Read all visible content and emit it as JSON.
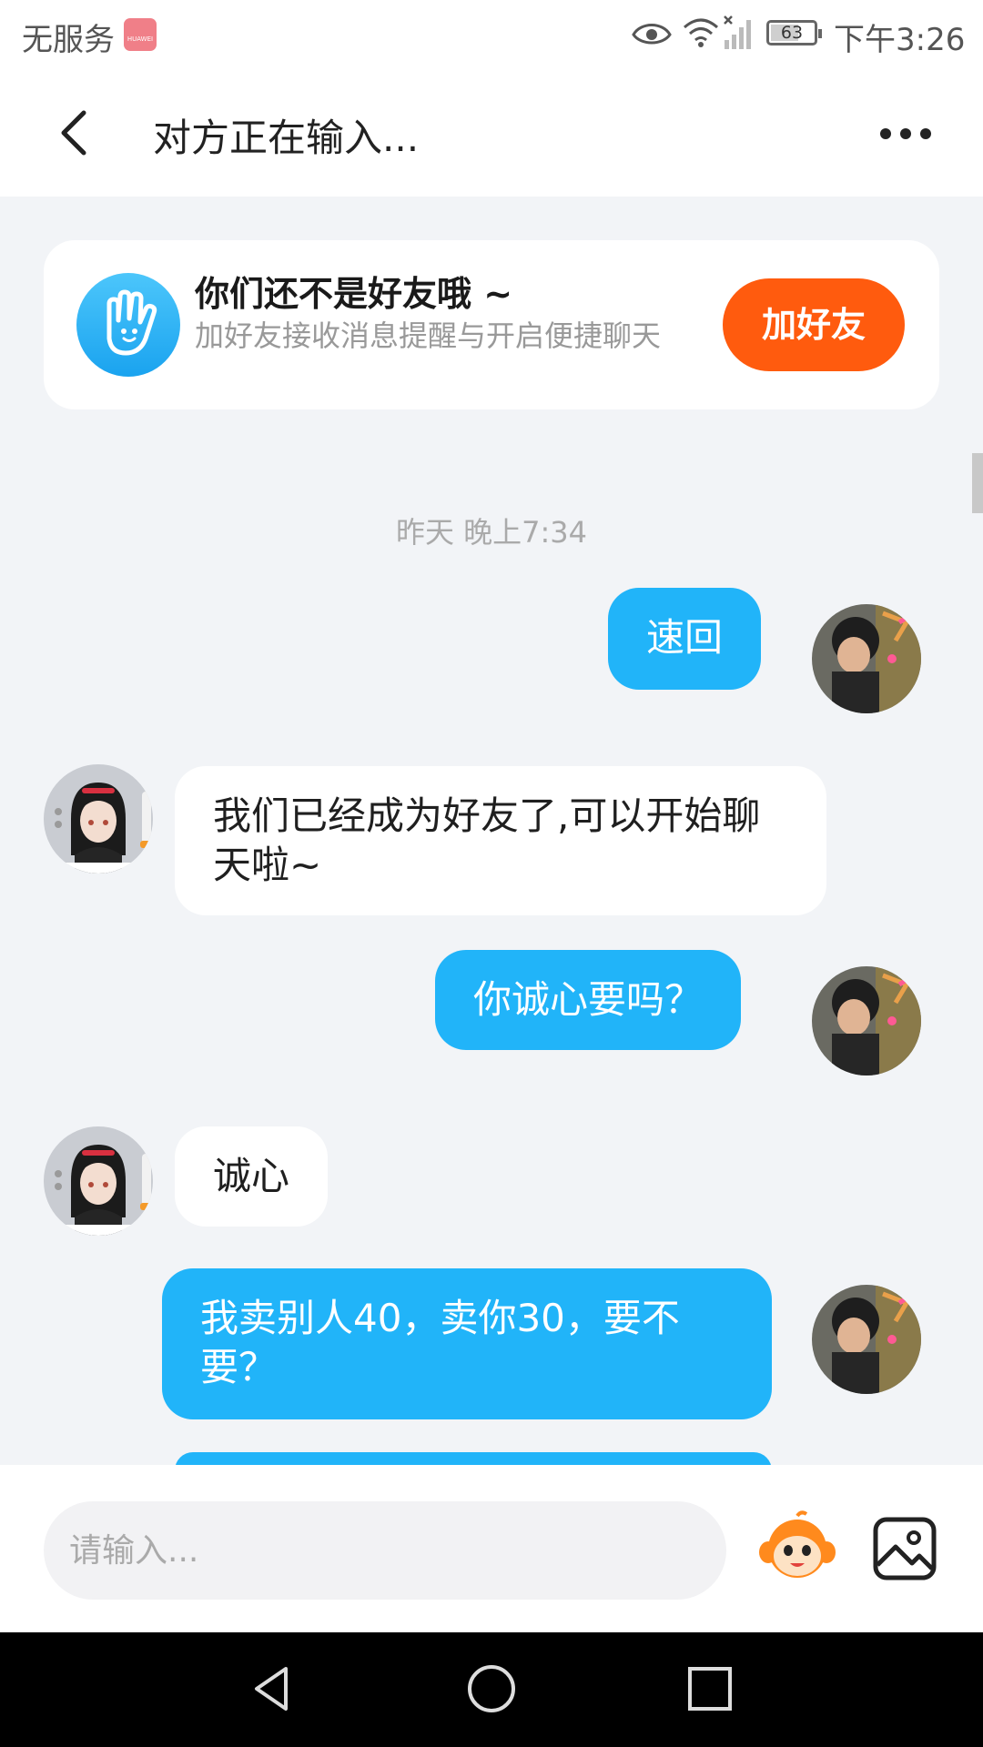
{
  "status_bar": {
    "carrier": "无服务",
    "carrier_badge": "HUAWEI",
    "battery": "63",
    "time": "下午3:26",
    "icons": [
      "eye-icon",
      "wifi-icon",
      "signal-icon",
      "battery-icon"
    ]
  },
  "header": {
    "title": "对方正在输入...",
    "back_icon": "chevron-left-icon",
    "more_icon": "more-dots-icon"
  },
  "friend_card": {
    "title": "你们还不是好友哦 ~",
    "subtitle": "加好友接收消息提醒与开启便捷聊天",
    "button_label": "加好友",
    "icon": "hand-icon"
  },
  "timestamp": "昨天 晚上7:34",
  "messages": [
    {
      "direction": "out",
      "text": "速回"
    },
    {
      "direction": "in",
      "text": "我们已经成为好友了,可以开始聊天啦~"
    },
    {
      "direction": "out",
      "text": "你诚心要吗？"
    },
    {
      "direction": "in",
      "text": "诚心"
    },
    {
      "direction": "out",
      "text": "我卖别人40，卖你30，要不要？"
    }
  ],
  "input_bar": {
    "placeholder": "请输入...",
    "emoji_icon": "emoji-monkey-icon",
    "image_icon": "image-icon"
  },
  "colors": {
    "accent_blue": "#21b4f9",
    "accent_orange": "#ff5b0e",
    "background": "#f2f4f7"
  }
}
